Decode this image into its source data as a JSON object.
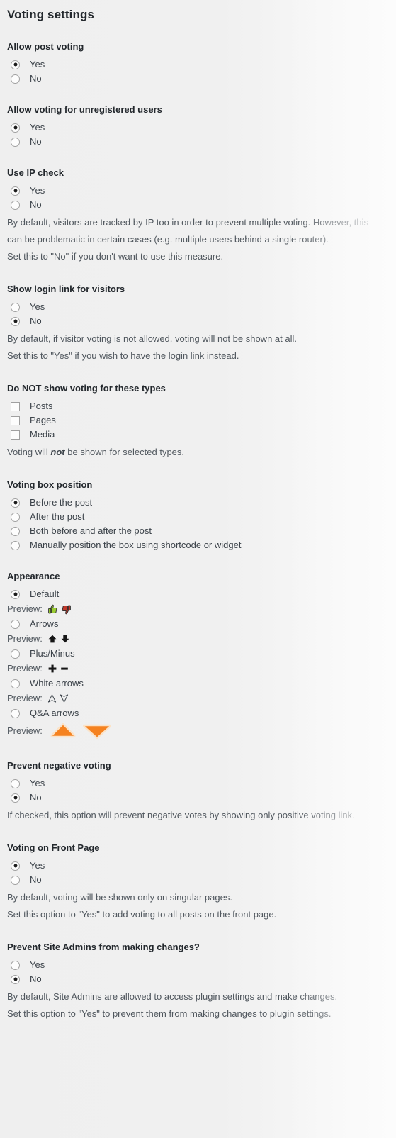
{
  "page": {
    "title": "Voting settings"
  },
  "groups": [
    {
      "id": "allow-post-voting",
      "title": "Allow post voting",
      "options": [
        {
          "label": "Yes",
          "selected": true
        },
        {
          "label": "No",
          "selected": false
        }
      ],
      "descriptions": []
    },
    {
      "id": "allow-unregistered",
      "title": "Allow voting for unregistered users",
      "options": [
        {
          "label": "Yes",
          "selected": true
        },
        {
          "label": "No",
          "selected": false
        }
      ],
      "descriptions": []
    },
    {
      "id": "use-ip-check",
      "title": "Use IP check",
      "options": [
        {
          "label": "Yes",
          "selected": true
        },
        {
          "label": "No",
          "selected": false
        }
      ],
      "descriptions": [
        "By default, visitors are tracked by IP too in order to prevent multiple voting. However, this can be problematic in certain cases (e.g. multiple users behind a single router).",
        "Set this to \"No\" if you don't want to use this measure."
      ]
    },
    {
      "id": "show-login-link",
      "title": "Show login link for visitors",
      "options": [
        {
          "label": "Yes",
          "selected": false
        },
        {
          "label": "No",
          "selected": true
        }
      ],
      "descriptions": [
        "By default, if visitor voting is not allowed, voting will not be shown at all.",
        "Set this to \"Yes\" if you wish to have the login link instead."
      ]
    },
    {
      "id": "hide-voting-types",
      "title": "Do NOT show voting for these types",
      "checkboxes": [
        {
          "label": "Posts",
          "checked": false
        },
        {
          "label": "Pages",
          "checked": false
        },
        {
          "label": "Media",
          "checked": false
        }
      ],
      "description_html": "Voting will <em>not</em> be shown for selected types."
    },
    {
      "id": "voting-box-position",
      "title": "Voting box position",
      "options": [
        {
          "label": "Before the post",
          "selected": true
        },
        {
          "label": "After the post",
          "selected": false
        },
        {
          "label": "Both before and after the post",
          "selected": false
        },
        {
          "label": "Manually position the box using shortcode or widget",
          "selected": false
        }
      ],
      "descriptions": []
    },
    {
      "id": "appearance",
      "title": "Appearance",
      "preview_label": "Preview:",
      "appearance_options": [
        {
          "label": "Default",
          "selected": true,
          "icons": [
            "thumbs-up-green-icon",
            "thumbs-down-red-icon"
          ],
          "style": "default"
        },
        {
          "label": "Arrows",
          "selected": false,
          "icons": [
            "arrow-up-black-icon",
            "arrow-down-black-icon"
          ],
          "style": "arrows"
        },
        {
          "label": "Plus/Minus",
          "selected": false,
          "icons": [
            "plus-black-icon",
            "minus-black-icon"
          ],
          "style": "plusminus"
        },
        {
          "label": "White arrows",
          "selected": false,
          "icons": [
            "arrow-up-outline-icon",
            "arrow-down-outline-icon"
          ],
          "style": "whitearrows"
        },
        {
          "label": "Q&A arrows",
          "selected": false,
          "icons": [
            "triangle-up-orange-icon",
            "triangle-down-orange-icon"
          ],
          "style": "qa"
        }
      ]
    },
    {
      "id": "prevent-negative-voting",
      "title": "Prevent negative voting",
      "options": [
        {
          "label": "Yes",
          "selected": false
        },
        {
          "label": "No",
          "selected": true
        }
      ],
      "descriptions": [
        "If checked, this option will prevent negative votes by showing only positive voting link."
      ]
    },
    {
      "id": "voting-front-page",
      "title": "Voting on Front Page",
      "options": [
        {
          "label": "Yes",
          "selected": true
        },
        {
          "label": "No",
          "selected": false
        }
      ],
      "descriptions": [
        "By default, voting will be shown only on singular pages.",
        "Set this option to \"Yes\" to add voting to all posts on the front page."
      ]
    },
    {
      "id": "prevent-site-admins",
      "title": "Prevent Site Admins from making changes?",
      "options": [
        {
          "label": "Yes",
          "selected": false
        },
        {
          "label": "No",
          "selected": true
        }
      ],
      "descriptions": [
        "By default, Site Admins are allowed to access plugin settings and make changes.",
        "Set this option to \"Yes\" to prevent them from making changes to plugin settings."
      ]
    }
  ],
  "colors": {
    "heading": "#23282d",
    "label": "#3c434a",
    "description": "#50575e",
    "background_start": "#efefef",
    "background_end": "#fbfbfb",
    "thumbs_up_green": "#9acd32",
    "thumbs_down_red": "#c0392b",
    "qa_orange": "#f58220",
    "qa_outline": "#fbe3c8"
  }
}
